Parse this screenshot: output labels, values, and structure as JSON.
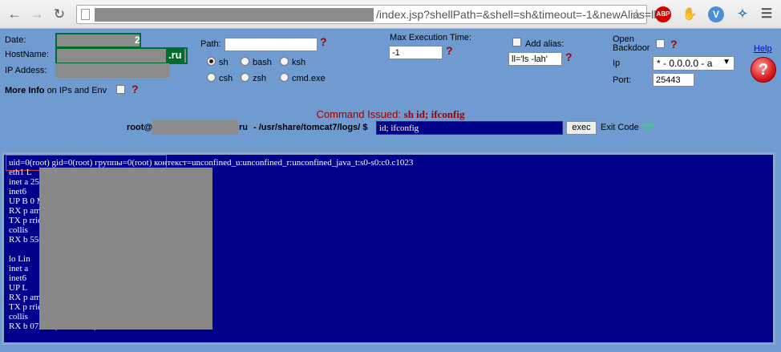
{
  "browser": {
    "url_text": "/index.jsp?shellPath=&shell=sh&timeout=-1&newAlias=ll",
    "ext_abp": "ABP"
  },
  "form": {
    "date_label": "Date:",
    "date_suffix": "2",
    "hostname_label": "HostName:",
    "hostname_suffix": ".ru",
    "ip_label": "IP Addess:",
    "more_info_bold": "More Info",
    "more_info_rest": "on IPs and Env",
    "path_label": "Path:",
    "path_value": "",
    "shells": [
      {
        "label": "sh",
        "selected": true
      },
      {
        "label": "bash",
        "selected": false
      },
      {
        "label": "ksh",
        "selected": false
      },
      {
        "label": "csh",
        "selected": false
      },
      {
        "label": "zsh",
        "selected": false
      },
      {
        "label": "cmd.exe",
        "selected": false
      }
    ],
    "max_exec_label": "Max Execution Time:",
    "max_exec_value": "-1",
    "add_alias_label": "Add alias:",
    "alias_value": "ll='ls -lah'",
    "open_backdoor_label_1": "Open",
    "open_backdoor_label_2": "Backdoor",
    "ip_select_label": "Ip",
    "ip_select_value": "* - 0.0.0.0 - a",
    "port_label": "Port:",
    "port_value": "25443",
    "help_label": "Help",
    "help_glyph": "?",
    "question_glyph": "?"
  },
  "command": {
    "issued_label": "Command Issued:",
    "issued_cmd": "sh id; ifconfig",
    "prompt_user": "root@",
    "prompt_host_suffix": "ru",
    "prompt_path": "- /usr/share/tomcat7/logs/ $",
    "input_value": "id; ifconfig",
    "exec_label": "exec",
    "exit_code_label": "Exit Code",
    "exit_code_value": "\"0\""
  },
  "output": {
    "lines": [
      "uid=0(root) gid=0(root) группы=0(root) контекст=unconfined_u:unconfined_r:unconfined_java_t:s0-s0:c0.c1023",
      "eth1 L",
      "inet a                                                                     255.255.0",
      "inet6",
      "UP B                                                                     0 Metric:1",
      "RX p                                                                     ame:0",
      "TX p                                                                     rrier:0",
      "collis",
      "RX b                                                                     556 (245.4 GiB)",
      "",
      "lo Lin",
      "inet a",
      "inet6",
      "UP L",
      "RX p                                                                     ame:0",
      "TX p                                                                     rrier:0",
      "collis",
      "RX b                                                                     07238 (386.7 GiB)"
    ]
  },
  "colors": {
    "panel_bg": "#6f9bd0",
    "output_bg": "#00008b",
    "issued_red": "#9c0000",
    "exit_green": "#33dd66"
  }
}
